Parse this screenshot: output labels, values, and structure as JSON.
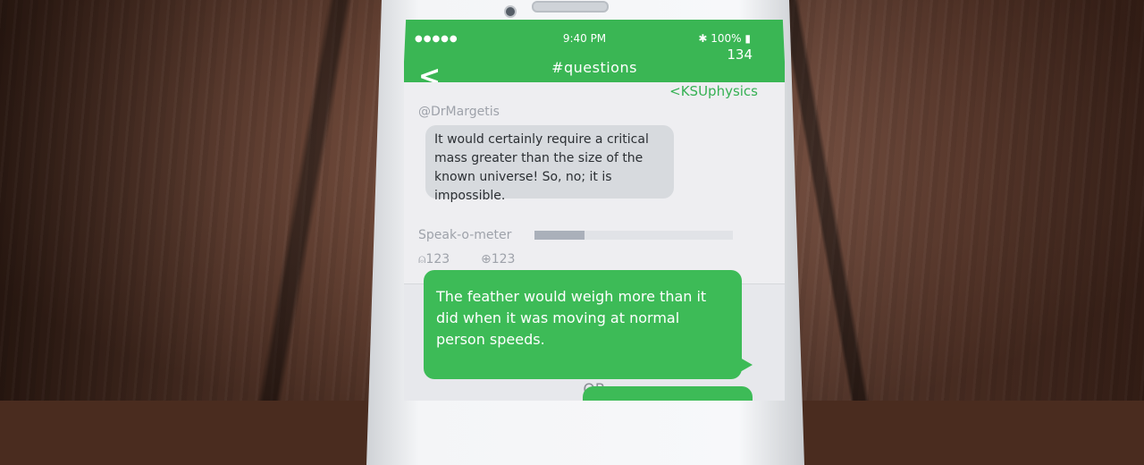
{
  "status_bar": {
    "signal": "●●●●● ",
    "time": "9:40 PM",
    "battery": "100%"
  },
  "nav": {
    "back": "<",
    "title": "#questions",
    "count": "134"
  },
  "topic": {
    "link": "<KSUphysics",
    "handle": "@DrMargetis"
  },
  "incoming_message": "It would certainly require a critical mass greater than the size of the known universe! So, no; it is impossible.",
  "speak_meter": {
    "label": "Speak-o-meter",
    "level_fraction": 0.25
  },
  "stats": {
    "listeners": "123",
    "upvotes": "123"
  },
  "answer_message": "The feather would weigh more than it did when it was moving at normal person speeds.",
  "separator": "OR",
  "colors": {
    "accent": "#3ab654",
    "incoming_bubble": "#d7dade"
  }
}
